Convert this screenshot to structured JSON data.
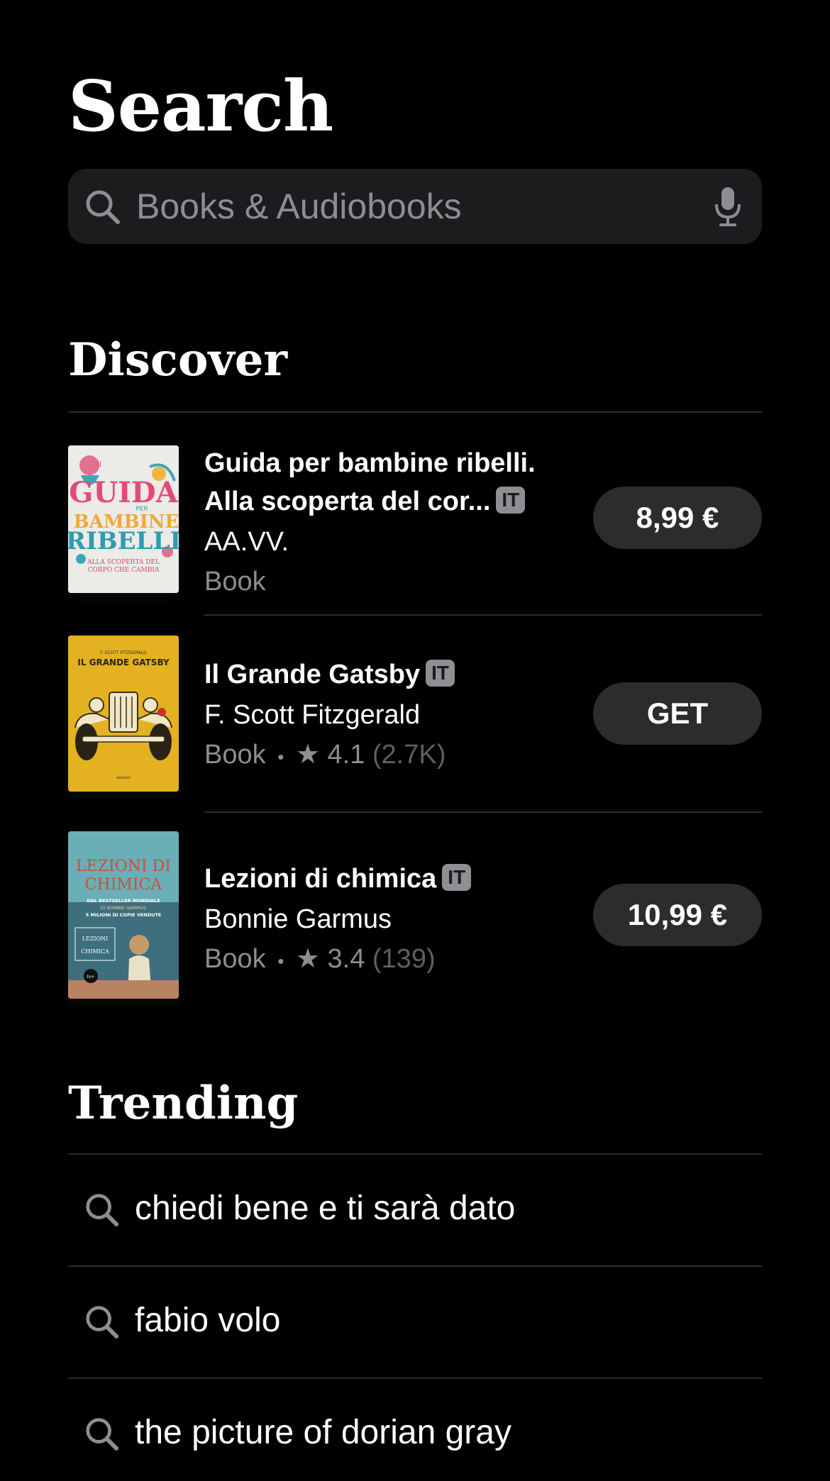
{
  "header": {
    "title": "Search"
  },
  "search": {
    "placeholder": "Books & Audiobooks",
    "search_icon": "search-icon",
    "mic_icon": "microphone-icon"
  },
  "discover": {
    "title": "Discover",
    "items": [
      {
        "title_line1": "Guida per bambine ribelli.",
        "title_line2": "Alla scoperta del cor...",
        "badge": "IT",
        "author": "AA.VV.",
        "type": "Book",
        "price": "8,99 €",
        "cover": {
          "top_text": "Il",
          "title": "GUIDA",
          "mid_text": "PER",
          "title2": "BAMBINE",
          "title3": "RIBELLI",
          "subtitle": "ALLA SCOPERTA DEL CORPO CHE CAMBIA",
          "bg": "#ecebe8"
        }
      },
      {
        "title": "Il Grande Gatsby",
        "badge": "IT",
        "author": "F. Scott Fitzgerald",
        "type": "Book",
        "separator": "•",
        "rating": "4.1",
        "count": "(2.7K)",
        "price": "GET",
        "cover": {
          "author": "F. SCOTT FITZGERALD",
          "title": "IL GRANDE GATSBY",
          "bg": "#e4b220"
        }
      },
      {
        "title": "Lezioni di chimica",
        "badge": "IT",
        "author": "Bonnie Garmus",
        "type": "Book",
        "separator": "•",
        "rating": "3.4",
        "count": "(139)",
        "price": "10,99 €",
        "cover": {
          "title1": "LEZIONI DI",
          "title2": "CHIMICA",
          "tag1": "DAL BESTSELLER MONDIALE",
          "tag2": "DI BONNIE GARMUS",
          "tag3": "5 MILIONI DI COPIE VENDUTE",
          "box1": "LEZIONI",
          "box2": "CHIMICA",
          "bg": "#5fa3ad"
        }
      }
    ]
  },
  "trending": {
    "title": "Trending",
    "items": [
      {
        "text": "chiedi bene e ti sarà dato"
      },
      {
        "text": "fabio volo"
      },
      {
        "text": "the picture of dorian gray"
      }
    ]
  },
  "colors": {
    "background": "#000000",
    "surface": "#1c1c1e",
    "button": "#2c2c2e",
    "secondary_text": "#8d8d93"
  }
}
